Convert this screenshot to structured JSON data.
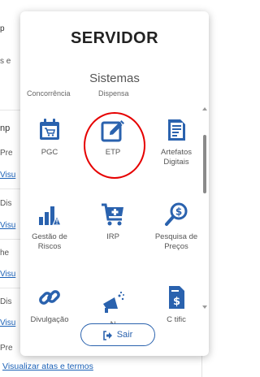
{
  "background": {
    "side_texts": [
      "p",
      "s e",
      "np",
      "Pre",
      "Visu",
      "Dis",
      "Visu",
      "he",
      "Visu",
      "Dis",
      "Visu",
      "Pre"
    ],
    "bottom_link": "Visualizar atas e termos"
  },
  "modal": {
    "title": "SERVIDOR",
    "subtitle": "Sistemas",
    "partial_row": [
      "Concorrência",
      "Dispensa"
    ],
    "apps": [
      {
        "label": "PGC",
        "icon": "calendar-cart-icon"
      },
      {
        "label": "ETP",
        "icon": "edit-pencil-icon"
      },
      {
        "label": "Artefatos Digitais",
        "icon": "document-icon"
      },
      {
        "label": "Gestão de Riscos",
        "icon": "risk-chart-icon"
      },
      {
        "label": "IRP",
        "icon": "cart-plus-icon"
      },
      {
        "label": "Pesquisa de Preços",
        "icon": "price-search-icon"
      },
      {
        "label": "Divulgação de",
        "icon": "link-icon"
      },
      {
        "label": "N",
        "icon": "megaphone-icon"
      },
      {
        "label": "C  tific",
        "icon": "money-document-icon"
      }
    ],
    "sair_button": "Sair",
    "colors": {
      "icon_blue": "#2a62ae",
      "highlight_red": "#e60000",
      "title_dark": "#222222"
    }
  }
}
